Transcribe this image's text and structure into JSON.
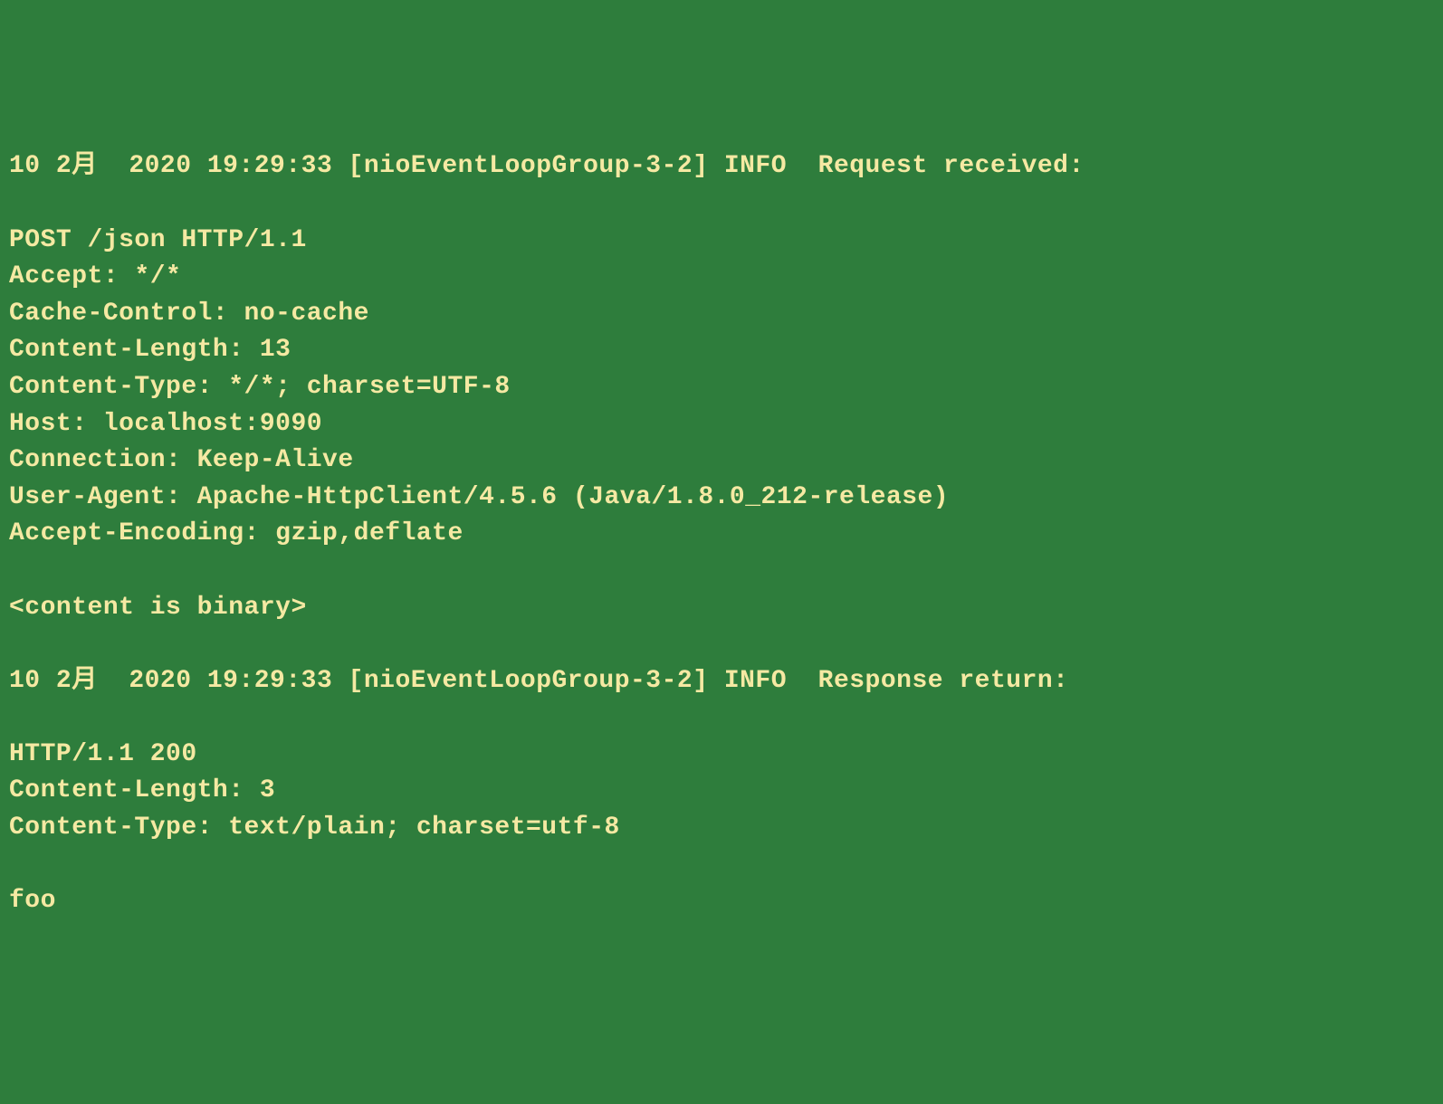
{
  "terminal": {
    "lines": [
      "10 2月  2020 19:29:33 [nioEventLoopGroup-3-2] INFO  Request received:",
      "",
      "POST /json HTTP/1.1",
      "Accept: */*",
      "Cache-Control: no-cache",
      "Content-Length: 13",
      "Content-Type: */*; charset=UTF-8",
      "Host: localhost:9090",
      "Connection: Keep-Alive",
      "User-Agent: Apache-HttpClient/4.5.6 (Java/1.8.0_212-release)",
      "Accept-Encoding: gzip,deflate",
      "",
      "<content is binary>",
      "",
      "10 2月  2020 19:29:33 [nioEventLoopGroup-3-2] INFO  Response return:",
      "",
      "HTTP/1.1 200",
      "Content-Length: 3",
      "Content-Type: text/plain; charset=utf-8",
      "",
      "foo"
    ]
  },
  "colors": {
    "background": "#2e7d3c",
    "text": "#f5e9a3"
  }
}
